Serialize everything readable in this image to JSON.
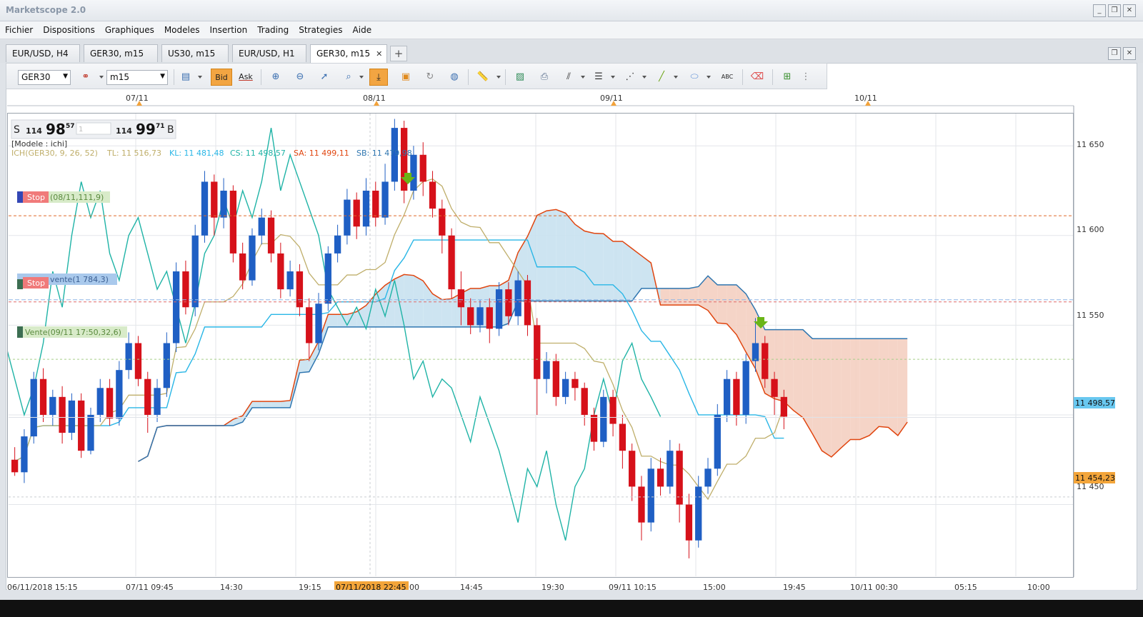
{
  "window": {
    "title": "Marketscope 2.0",
    "controls": [
      "_",
      "❐",
      "✕"
    ]
  },
  "menu": [
    "Fichier",
    "Dispositions",
    "Graphiques",
    "Modeles",
    "Insertion",
    "Trading",
    "Strategies",
    "Aide"
  ],
  "tabs": [
    {
      "label": "EUR/USD, H4",
      "active": false
    },
    {
      "label": "GER30, m15",
      "active": false
    },
    {
      "label": "US30, m15",
      "active": false
    },
    {
      "label": "EUR/USD, H1",
      "active": false
    },
    {
      "label": "GER30, m15",
      "active": true
    }
  ],
  "tab_close": "✕",
  "tab_add": "+",
  "toolbar": {
    "instrument": "GER30",
    "timeframe": "m15",
    "bid_label": "Bid",
    "ask_label": "Ask"
  },
  "quote": {
    "sell_prefix": "S",
    "sell_big": "114",
    "sell_main": "98",
    "sell_sup": "57",
    "amount": "1",
    "buy_big": "114",
    "buy_main": "99",
    "buy_sup": "71",
    "buy_prefix": "B"
  },
  "legend": {
    "model": "[Modele : ichi]",
    "ich": "ICH(GER30, 9, 26, 52)",
    "tl": "TL: 11 516,73",
    "kl": "KL: 11 481,48",
    "cs": "CS: 11 498,57",
    "sa": "SA: 11 499,11",
    "sb": "SB: 11 479,98"
  },
  "orders": {
    "stop1_tag": "Stop",
    "stop1_text": "(08/11,111,9)",
    "stop2_tag": "Stop",
    "stop2_text": "vente(1 784,3)",
    "sell_text": "Vente(09/11 17:50,32,6)"
  },
  "top_dates": [
    "07/11",
    "08/11",
    "09/11",
    "10/11"
  ],
  "price_axis": [
    "11 650",
    "11 600",
    "11 550",
    "11 500",
    "11 450"
  ],
  "price_tags": {
    "current": "11 498,57",
    "stop": "11 454,23"
  },
  "time_axis": [
    "06/11/2018 15:15",
    "07/11 09:45",
    "14:30",
    "19:15",
    "00",
    "14:45",
    "19:30",
    "09/11 10:15",
    "15:00",
    "19:45",
    "10/11 00:30",
    "05:15",
    "10:00"
  ],
  "time_highlight": "07/11/2018 22:45",
  "colors": {
    "bull": "#1f5fc4",
    "bear": "#d6111a",
    "tenkan": "#bfae6a",
    "kijun": "#29b6e6",
    "chikou": "#1fb3a6",
    "senkou_a": "#e0450f",
    "senkou_b": "#2f76b0",
    "cloud_bull": "#c8e1ef",
    "cloud_bear": "#f4cfc1"
  },
  "chart_data": {
    "type": "candlestick",
    "instrument": "GER30",
    "timeframe": "m15",
    "ylim": [
      11410,
      11668
    ],
    "y_ticks": [
      11650,
      11600,
      11550,
      11500,
      11450
    ],
    "levels": {
      "stop_buy": 11611,
      "stop_sell": 11563,
      "sell_entry": 11531,
      "stop_price": 11454.23,
      "current": 11498.57
    },
    "candles": [
      [
        11475,
        11468,
        11482,
        11466
      ],
      [
        11468,
        11488,
        11492,
        11462
      ],
      [
        11488,
        11520,
        11524,
        11484
      ],
      [
        11520,
        11500,
        11526,
        11496
      ],
      [
        11500,
        11510,
        11514,
        11494
      ],
      [
        11510,
        11490,
        11516,
        11484
      ],
      [
        11490,
        11508,
        11512,
        11486
      ],
      [
        11508,
        11480,
        11512,
        11476
      ],
      [
        11480,
        11500,
        11504,
        11478
      ],
      [
        11500,
        11515,
        11520,
        11496
      ],
      [
        11515,
        11498,
        11520,
        11494
      ],
      [
        11498,
        11525,
        11530,
        11494
      ],
      [
        11525,
        11540,
        11546,
        11520
      ],
      [
        11540,
        11520,
        11544,
        11516
      ],
      [
        11520,
        11500,
        11524,
        11490
      ],
      [
        11500,
        11515,
        11520,
        11496
      ],
      [
        11515,
        11540,
        11546,
        11510
      ],
      [
        11540,
        11580,
        11585,
        11535
      ],
      [
        11580,
        11560,
        11586,
        11556
      ],
      [
        11560,
        11600,
        11606,
        11555
      ],
      [
        11600,
        11630,
        11636,
        11596
      ],
      [
        11630,
        11610,
        11634,
        11600
      ],
      [
        11610,
        11625,
        11632,
        11604
      ],
      [
        11625,
        11590,
        11628,
        11585
      ],
      [
        11590,
        11575,
        11596,
        11570
      ],
      [
        11575,
        11600,
        11604,
        11572
      ],
      [
        11600,
        11610,
        11615,
        11595
      ],
      [
        11610,
        11590,
        11614,
        11585
      ],
      [
        11590,
        11570,
        11596,
        11565
      ],
      [
        11570,
        11580,
        11586,
        11566
      ],
      [
        11580,
        11560,
        11584,
        11555
      ],
      [
        11560,
        11540,
        11565,
        11530
      ],
      [
        11540,
        11562,
        11568,
        11536
      ],
      [
        11562,
        11590,
        11594,
        11558
      ],
      [
        11590,
        11600,
        11606,
        11585
      ],
      [
        11600,
        11620,
        11626,
        11595
      ],
      [
        11620,
        11605,
        11624,
        11598
      ],
      [
        11605,
        11625,
        11632,
        11600
      ],
      [
        11625,
        11610,
        11630,
        11605
      ],
      [
        11610,
        11630,
        11640,
        11606
      ],
      [
        11630,
        11660,
        11665,
        11625
      ],
      [
        11660,
        11625,
        11664,
        11618
      ],
      [
        11625,
        11645,
        11650,
        11620
      ],
      [
        11645,
        11630,
        11652,
        11622
      ],
      [
        11630,
        11615,
        11636,
        11610
      ],
      [
        11615,
        11600,
        11620,
        11590
      ],
      [
        11600,
        11570,
        11604,
        11565
      ],
      [
        11570,
        11560,
        11580,
        11550
      ],
      [
        11560,
        11550,
        11565,
        11545
      ],
      [
        11550,
        11560,
        11564,
        11546
      ],
      [
        11560,
        11548,
        11565,
        11540
      ],
      [
        11548,
        11570,
        11574,
        11544
      ],
      [
        11570,
        11555,
        11574,
        11550
      ],
      [
        11555,
        11575,
        11580,
        11550
      ],
      [
        11575,
        11550,
        11578,
        11544
      ],
      [
        11550,
        11520,
        11554,
        11500
      ],
      [
        11520,
        11530,
        11535,
        11512
      ],
      [
        11530,
        11510,
        11534,
        11505
      ],
      [
        11510,
        11520,
        11524,
        11506
      ],
      [
        11520,
        11515,
        11524,
        11508
      ],
      [
        11515,
        11500,
        11518,
        11494
      ],
      [
        11500,
        11485,
        11504,
        11480
      ],
      [
        11485,
        11510,
        11514,
        11482
      ],
      [
        11510,
        11495,
        11514,
        11488
      ],
      [
        11495,
        11480,
        11500,
        11470
      ],
      [
        11480,
        11460,
        11484,
        11452
      ],
      [
        11460,
        11440,
        11466,
        11430
      ],
      [
        11440,
        11470,
        11476,
        11435
      ],
      [
        11470,
        11460,
        11476,
        11455
      ],
      [
        11460,
        11480,
        11486,
        11456
      ],
      [
        11480,
        11450,
        11484,
        11440
      ],
      [
        11450,
        11430,
        11456,
        11420
      ],
      [
        11430,
        11460,
        11466,
        11426
      ],
      [
        11460,
        11470,
        11476,
        11456
      ],
      [
        11470,
        11500,
        11506,
        11466
      ],
      [
        11500,
        11520,
        11525,
        11496
      ],
      [
        11520,
        11500,
        11524,
        11494
      ],
      [
        11500,
        11530,
        11534,
        11495
      ],
      [
        11530,
        11540,
        11554,
        11524
      ],
      [
        11540,
        11520,
        11544,
        11515
      ],
      [
        11520,
        11510,
        11524,
        11500
      ],
      [
        11510,
        11499,
        11514,
        11492
      ]
    ]
  }
}
